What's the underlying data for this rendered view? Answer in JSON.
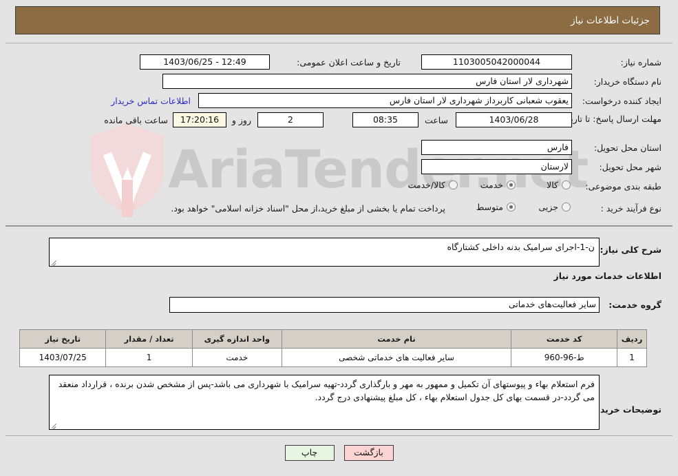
{
  "header": {
    "title": "جزئیات اطلاعات نیاز"
  },
  "watermark": {
    "text": "AriaTender.net",
    "shield_color": "#f0d8d8"
  },
  "top_section": {
    "need_number": {
      "label": "شماره نیاز:",
      "value": "1103005042000044"
    },
    "public_announcement": {
      "label": "تاریخ و ساعت اعلان عمومی:",
      "value": "12:49 - 1403/06/25"
    },
    "buyer_org": {
      "label": "نام دستگاه خریدار:",
      "value": "شهرداری لار استان فارس"
    },
    "requester": {
      "label": "ایجاد کننده درخواست:",
      "value": "یعقوب شعبانی کاربرداز شهرداری لار استان فارس"
    },
    "contact_link": "اطلاعات تماس خریدار",
    "deadline": {
      "label": "مهلت ارسال پاسخ: تا تاریخ:",
      "date": "1403/06/28",
      "time_label": "ساعت",
      "time": "08:35",
      "days": "2",
      "days_label": "روز و",
      "countdown": "17:20:16",
      "countdown_label": "ساعت باقی مانده"
    },
    "delivery_province": {
      "label": "استان محل تحویل:",
      "value": "فارس"
    },
    "delivery_city": {
      "label": "شهر محل تحویل:",
      "value": "لارستان"
    },
    "category": {
      "label": "طبقه بندی موضوعی:",
      "options": [
        {
          "label": "کالا",
          "selected": false
        },
        {
          "label": "خدمت",
          "selected": true
        },
        {
          "label": "کالا/خدمت",
          "selected": false
        }
      ]
    },
    "purchase_process": {
      "label": "نوع فرآیند خرید :",
      "options": [
        {
          "label": "جزیی",
          "selected": false
        },
        {
          "label": "متوسط",
          "selected": true
        }
      ],
      "note": "پرداخت تمام یا بخشی از مبلغ خرید،از محل \"اسناد خزانه اسلامی\" خواهد بود."
    }
  },
  "mid_section": {
    "general_desc": {
      "label": "شرح کلی نیاز:",
      "value": "ن-1-اجرای سرامیک بدنه داخلی کشتارگاه"
    },
    "services_heading": "اطلاعات خدمات مورد نیاز",
    "service_group": {
      "label": "گروه خدمت:",
      "value": "سایر فعالیت‌های خدماتی"
    },
    "table": {
      "columns": [
        "ردیف",
        "کد خدمت",
        "نام خدمت",
        "واحد اندازه گیری",
        "تعداد / مقدار",
        "تاریخ نیاز"
      ],
      "rows": [
        {
          "radif": "1",
          "code": "ط-96-960",
          "name": "سایر فعالیت های خدماتی شخصی",
          "unit": "خدمت",
          "qty": "1",
          "date": "1403/07/25"
        }
      ]
    },
    "buyer_notes": {
      "label": "توضیحات خریدار:",
      "value": "فرم استعلام بهاء و پیوستهای آن تکمیل و ممهور به مهر و بارگذاری گردد-تهیه سرامیک با شهرداری می باشد-پس از مشخص  شدن برنده ، قرارداد منعقد می گردد-در قسمت بهای کل جدول استعلام بهاء ، کل مبلغ پیشنهادی درج گردد."
    }
  },
  "footer": {
    "back_label": "بازگشت",
    "print_label": "چاپ"
  }
}
